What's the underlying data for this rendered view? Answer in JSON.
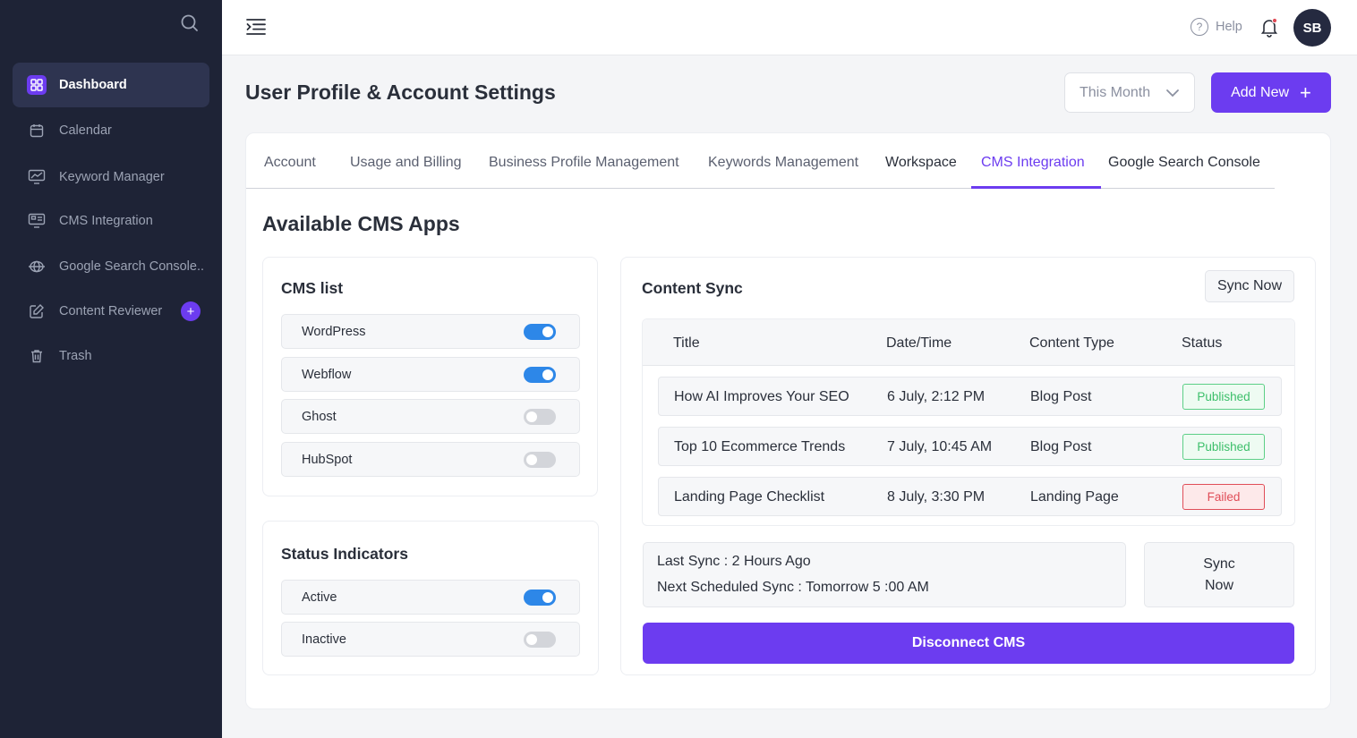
{
  "sidebar": {
    "items": [
      {
        "label": "Dashboard",
        "icon": "grid-icon"
      },
      {
        "label": "Calendar",
        "icon": "calendar-icon"
      },
      {
        "label": "Keyword Manager",
        "icon": "chart-monitor-icon"
      },
      {
        "label": "CMS Integration",
        "icon": "cms-monitor-icon"
      },
      {
        "label": "Google Search Console..",
        "icon": "globe-icon"
      },
      {
        "label": "Content Reviewer",
        "icon": "edit-icon",
        "badge": "+"
      },
      {
        "label": "Trash",
        "icon": "trash-icon"
      }
    ]
  },
  "topbar": {
    "help_label": "Help",
    "avatar_initials": "SB"
  },
  "header": {
    "title": "User Profile & Account Settings",
    "period_select": "This Month",
    "add_new_label": "Add New",
    "add_new_icon": "+"
  },
  "tabs": [
    {
      "label": "Account"
    },
    {
      "label": "Usage and Billing"
    },
    {
      "label": "Business Profile Management"
    },
    {
      "label": "Keywords Management"
    },
    {
      "label": "Workspace"
    },
    {
      "label": "CMS Integration",
      "active": true
    },
    {
      "label": "Google Search Console"
    }
  ],
  "section_title": "Available CMS Apps",
  "cms_list": {
    "title": "CMS list",
    "items": [
      {
        "label": "WordPress",
        "enabled": true
      },
      {
        "label": "Webflow",
        "enabled": true
      },
      {
        "label": "Ghost",
        "enabled": false
      },
      {
        "label": "HubSpot",
        "enabled": false
      }
    ]
  },
  "status_indicators": {
    "title": "Status Indicators",
    "items": [
      {
        "label": "Active",
        "enabled": true
      },
      {
        "label": "Inactive",
        "enabled": false
      }
    ]
  },
  "content_sync": {
    "title": "Content Sync",
    "sync_now_label": "Sync Now",
    "columns": [
      "Title",
      "Date/Time",
      "Content Type",
      "Status"
    ],
    "rows": [
      {
        "title": "How AI Improves Your SEO",
        "datetime": "6 July, 2:12 PM",
        "type": "Blog Post",
        "status": "Published"
      },
      {
        "title": "Top 10 Ecommerce Trends",
        "datetime": "7 July, 10:45 AM",
        "type": "Blog Post",
        "status": "Published"
      },
      {
        "title": "Landing Page Checklist",
        "datetime": "8 July, 3:30 PM",
        "type": "Landing Page",
        "status": "Failed"
      }
    ],
    "last_sync": "Last Sync :  2 Hours Ago",
    "next_sync": "Next Scheduled Sync : Tomorrow 5 :00 AM",
    "side_sync_line1": "Sync",
    "side_sync_line2": "Now",
    "disconnect_label": "Disconnect CMS"
  },
  "colors": {
    "accent": "#6c3cf0",
    "sidebar_bg": "#1e2336",
    "toggle_on": "#2d87e8",
    "published": "#3cbf6a",
    "failed": "#e04d58"
  }
}
